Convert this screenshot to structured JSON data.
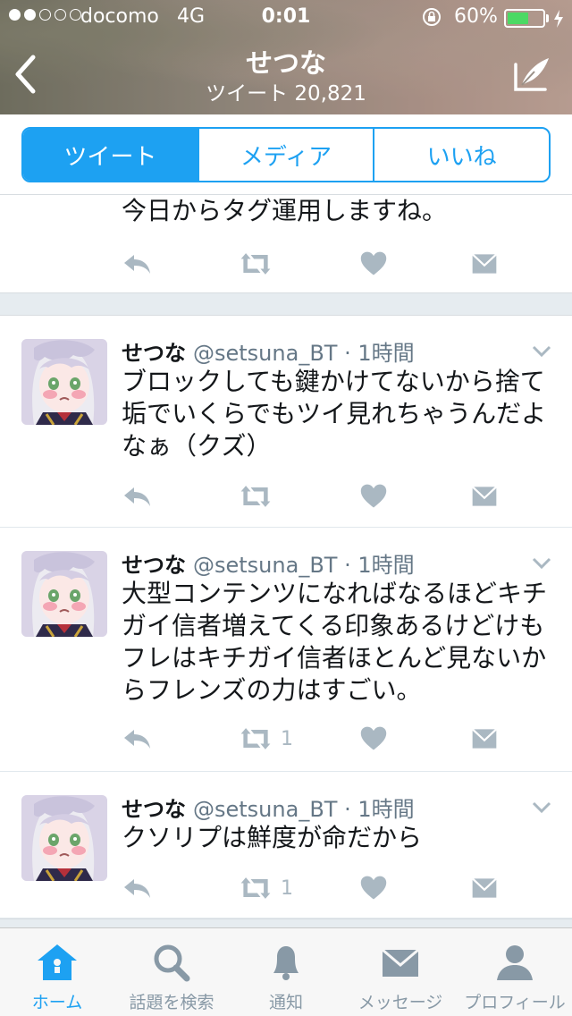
{
  "status_bar": {
    "carrier": "docomo",
    "network": "4G",
    "time": "0:01",
    "battery": "60%",
    "battery_level": 0.6
  },
  "header": {
    "title": "せつな",
    "subtitle": "ツイート 20,821"
  },
  "tabs": [
    {
      "label": "ツイート"
    },
    {
      "label": "メディア"
    },
    {
      "label": "いいね"
    }
  ],
  "partial_tweet": {
    "text": "今日からタグ運用しますね。"
  },
  "tweets": [
    {
      "name": "せつな",
      "meta": "@setsuna_BT · 1時間",
      "lines": [
        "ブロックしても鍵かけてないから捨て",
        "垢でいくらでもツイ見れちゃうんだよ",
        "なぁ（クズ）"
      ],
      "retweets": ""
    },
    {
      "name": "せつな",
      "meta": "@setsuna_BT · 1時間",
      "lines": [
        "大型コンテンツになればなるほどキチ",
        "ガイ信者増えてくる印象あるけどけも",
        "フレはキチガイ信者ほとんど見ないか",
        "らフレンズの力はすごい。"
      ],
      "retweets": "1"
    },
    {
      "name": "せつな",
      "meta": "@setsuna_BT · 1時間",
      "lines": [
        "クソリプは鮮度が命だから"
      ],
      "retweets": "1"
    }
  ],
  "tabbar": [
    {
      "label": "ホーム",
      "icon": "home-icon"
    },
    {
      "label": "話題を検索",
      "icon": "search-icon"
    },
    {
      "label": "通知",
      "icon": "bell-icon"
    },
    {
      "label": "メッセージ",
      "icon": "mail-icon"
    },
    {
      "label": "プロフィール",
      "icon": "profile-icon"
    }
  ],
  "colors": {
    "accent": "#1da1f2",
    "icon_gray": "#aab8c2",
    "battery_green": "#4cd964"
  }
}
